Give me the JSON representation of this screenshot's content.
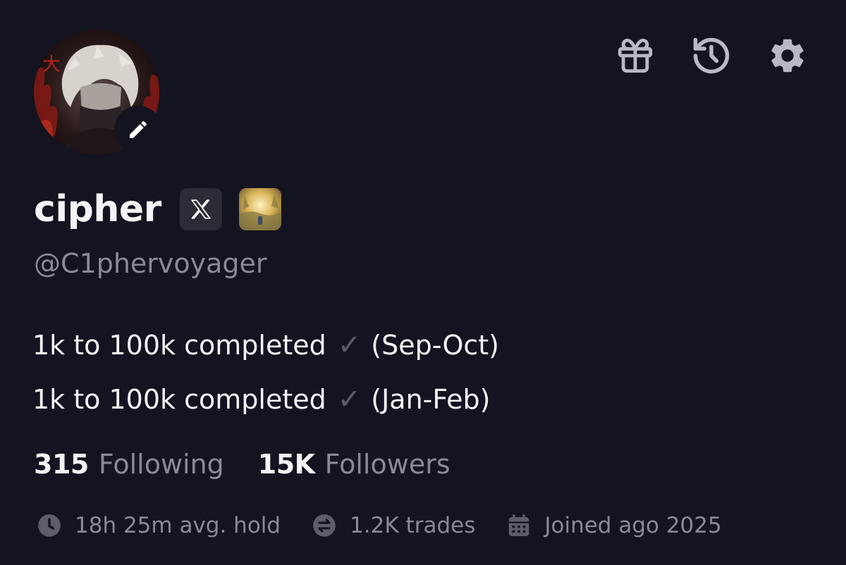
{
  "profile": {
    "display_name": "cipher",
    "handle": "@C1phervoyager",
    "bio": [
      {
        "text": "1k to 100k completed",
        "check": "✓",
        "period": "(Sep-Oct)"
      },
      {
        "text": "1k to 100k completed",
        "check": "✓",
        "period": "(Jan-Feb)"
      }
    ]
  },
  "stats": {
    "following_count": "315",
    "following_label": "Following",
    "followers_count": "15K",
    "followers_label": "Followers"
  },
  "meta": {
    "avg_hold": "18h 25m avg. hold",
    "trades": "1.2K trades",
    "joined": "Joined ago 2025"
  },
  "icons": {
    "top": [
      "gift-icon",
      "history-icon",
      "settings-gear-icon"
    ],
    "badges": [
      "x-logo-icon",
      "token-thumbnail"
    ],
    "meta": [
      "clock-icon",
      "swap-icon",
      "calendar-icon"
    ],
    "avatar_edit": "pencil-icon"
  },
  "colors": {
    "background": "#141320",
    "text_primary": "#f4f4f7",
    "text_secondary": "#8a8996",
    "icon": "#b9b8c4",
    "badge_bg": "#2c2c36"
  }
}
